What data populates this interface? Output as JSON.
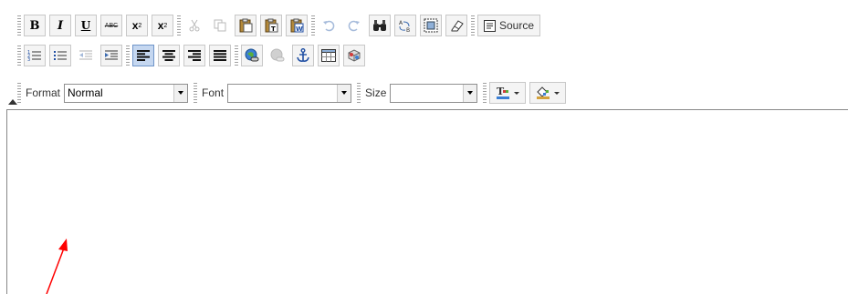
{
  "toolbar": {
    "row1": {
      "bold_label": "B",
      "italic_label": "I",
      "underline_label": "U",
      "strike_label": "ABC",
      "subscript_label": "x",
      "subscript_mark": "2",
      "superscript_label": "x",
      "superscript_mark": "2",
      "source_label": "Source"
    },
    "row3": {
      "format_label": "Format",
      "format_value": "Normal",
      "font_label": "Font",
      "font_value": "",
      "size_label": "Size",
      "size_value": ""
    }
  },
  "colors": {
    "annotation_arrow": "#ff0000",
    "active_button": "#c5d7f0",
    "toolbar_border": "#c8c8c8"
  },
  "icons": [
    "cut-icon",
    "copy-icon",
    "paste-icon",
    "paste-text-icon",
    "paste-word-icon",
    "undo-icon",
    "redo-icon",
    "find-icon",
    "replace-icon",
    "select-all-icon",
    "remove-format-icon",
    "source-icon",
    "numbered-list-icon",
    "bulleted-list-icon",
    "outdent-icon",
    "indent-icon",
    "align-left-icon",
    "align-center-icon",
    "align-right-icon",
    "justify-icon",
    "link-icon",
    "unlink-icon",
    "anchor-icon",
    "table-icon",
    "image-icon",
    "text-color-icon",
    "background-color-icon"
  ]
}
